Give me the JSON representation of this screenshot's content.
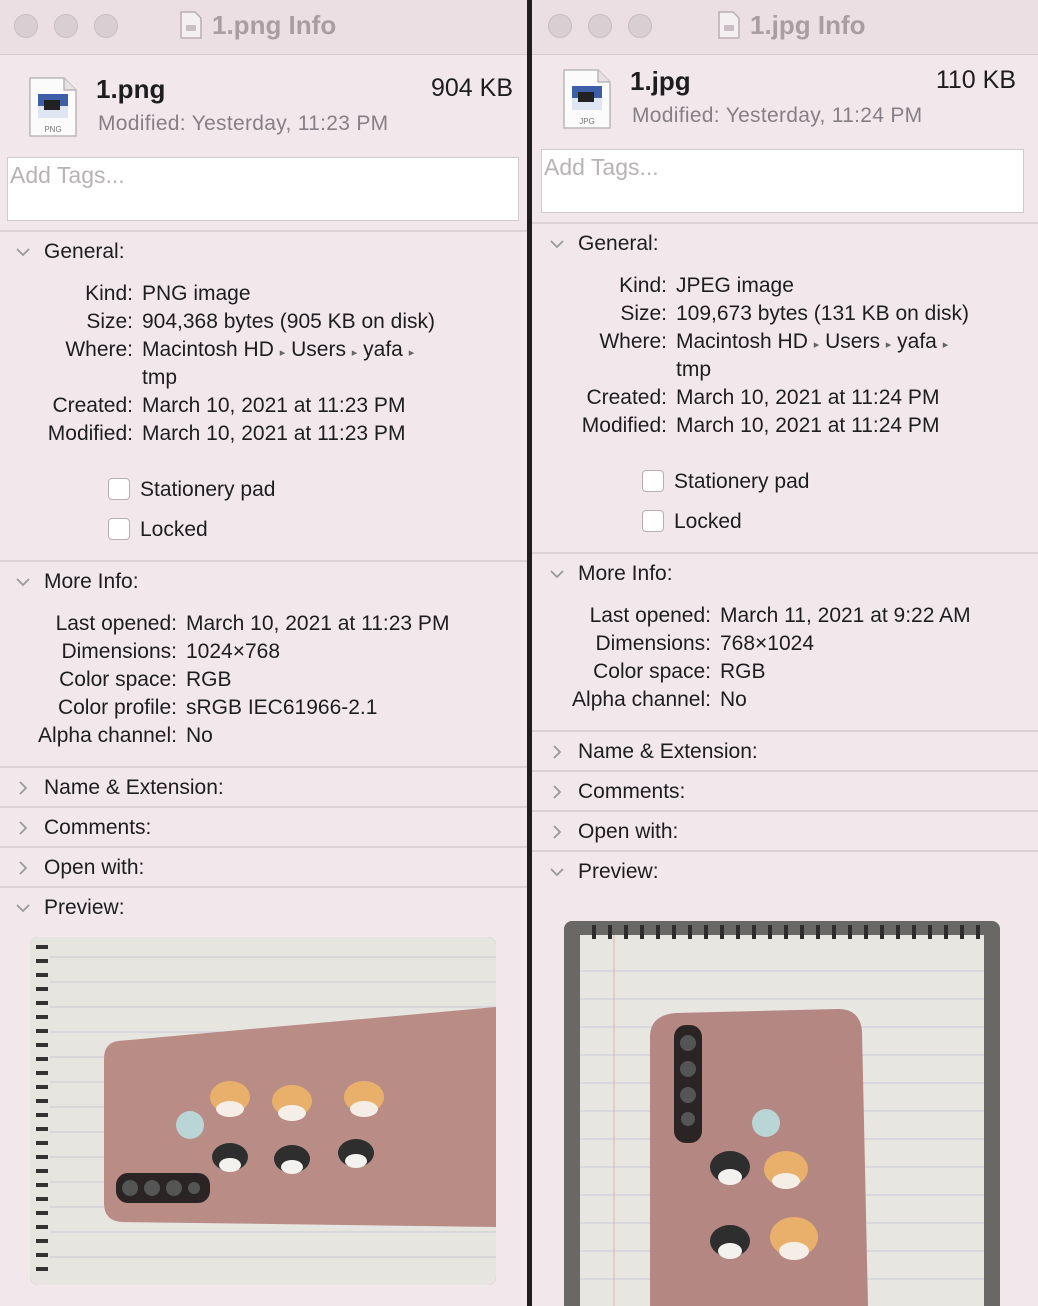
{
  "windows": [
    {
      "title": "1.png Info",
      "file_name": "1.png",
      "file_size": "904 KB",
      "modified_label": "Modified:",
      "modified_value": "Yesterday, 11:23 PM",
      "icon_badge": "PNG",
      "tags_placeholder": "Add Tags...",
      "general": {
        "title": "General:",
        "kind_label": "Kind:",
        "kind": "PNG image",
        "size_label": "Size:",
        "size": "904,368 bytes (905 KB on disk)",
        "where_label": "Where:",
        "where_1": "Macintosh HD",
        "where_2": "Users",
        "where_3": "yafa",
        "where_4": "tmp",
        "created_label": "Created:",
        "created": "March 10, 2021 at 11:23 PM",
        "modified_label": "Modified:",
        "modified": "March 10, 2021 at 11:23 PM",
        "stationery": "Stationery pad",
        "locked": "Locked"
      },
      "more_info": {
        "title": "More Info:",
        "last_opened_label": "Last opened:",
        "last_opened": "March 10, 2021 at 11:23 PM",
        "dimensions_label": "Dimensions:",
        "dimensions": "1024×768",
        "color_space_label": "Color space:",
        "color_space": "RGB",
        "color_profile_label": "Color profile:",
        "color_profile": "sRGB IEC61966-2.1",
        "alpha_label": "Alpha channel:",
        "alpha": "No"
      },
      "name_ext": "Name & Extension:",
      "comments": "Comments:",
      "open_with": "Open with:",
      "preview": "Preview:"
    },
    {
      "title": "1.jpg Info",
      "file_name": "1.jpg",
      "file_size": "110 KB",
      "modified_label": "Modified:",
      "modified_value": "Yesterday, 11:24 PM",
      "icon_badge": "JPG",
      "tags_placeholder": "Add Tags...",
      "general": {
        "title": "General:",
        "kind_label": "Kind:",
        "kind": "JPEG image",
        "size_label": "Size:",
        "size": "109,673 bytes (131 KB on disk)",
        "where_label": "Where:",
        "where_1": "Macintosh HD",
        "where_2": "Users",
        "where_3": "yafa",
        "where_4": "tmp",
        "created_label": "Created:",
        "created": "March 10, 2021 at 11:24 PM",
        "modified_label": "Modified:",
        "modified": "March 10, 2021 at 11:24 PM",
        "stationery": "Stationery pad",
        "locked": "Locked"
      },
      "more_info": {
        "title": "More Info:",
        "last_opened_label": "Last opened:",
        "last_opened": "March 11, 2021 at 9:22 AM",
        "dimensions_label": "Dimensions:",
        "dimensions": "768×1024",
        "color_space_label": "Color space:",
        "color_space": "RGB",
        "alpha_label": "Alpha channel:",
        "alpha": "No"
      },
      "name_ext": "Name & Extension:",
      "comments": "Comments:",
      "open_with": "Open with:",
      "preview": "Preview:"
    }
  ]
}
